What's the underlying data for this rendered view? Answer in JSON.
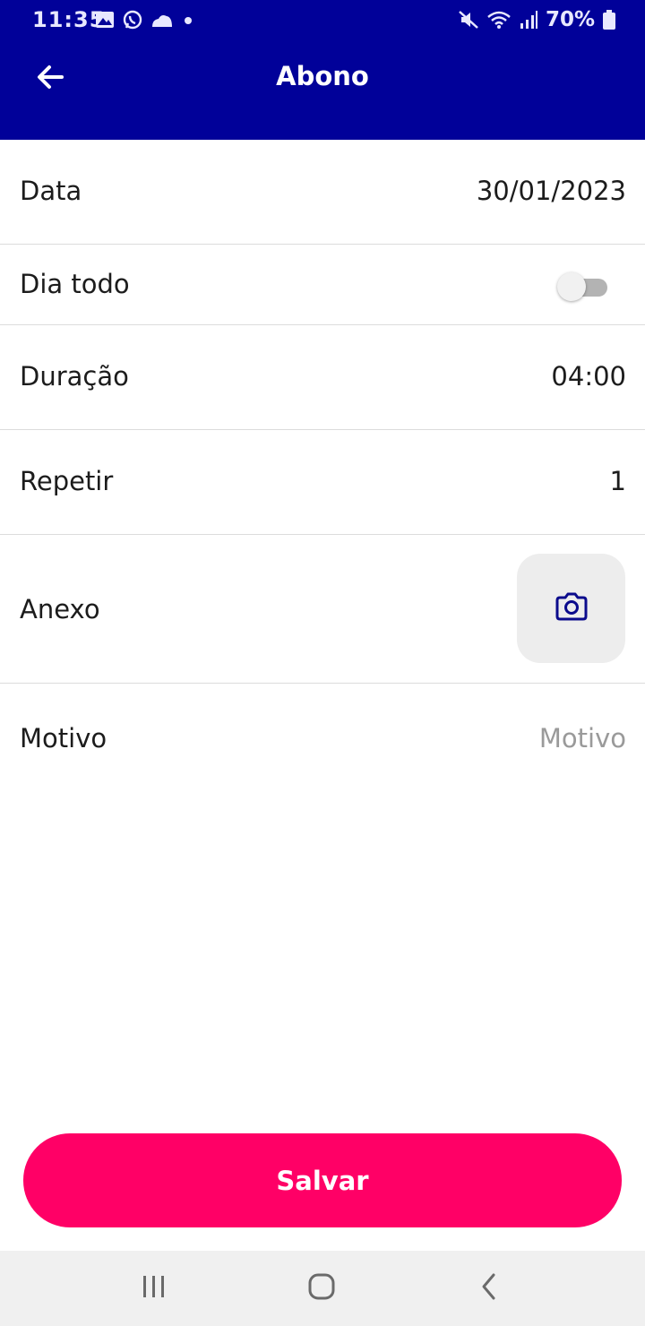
{
  "status_bar": {
    "time": "11:35",
    "battery": "70%",
    "icons": [
      "image-icon",
      "whatsapp-icon",
      "cloud-icon",
      "dot-icon",
      "mute-icon",
      "wifi-icon",
      "signal-icon",
      "battery-icon"
    ]
  },
  "app_bar": {
    "title": "Abono",
    "back_icon": "arrow-left-icon",
    "background": "#010199"
  },
  "form": {
    "data": {
      "label": "Data",
      "value": "30/01/2023"
    },
    "dia_todo": {
      "label": "Dia todo",
      "toggle_on": false
    },
    "duracao": {
      "label": "Duração",
      "value": "04:00"
    },
    "repetir": {
      "label": "Repetir",
      "value": "1"
    },
    "anexo": {
      "label": "Anexo",
      "button_icon": "camera-icon"
    },
    "motivo": {
      "label": "Motivo",
      "value": "",
      "placeholder": "Motivo"
    }
  },
  "save_button": {
    "label": "Salvar",
    "color": "#ff0066"
  },
  "nav_bar": {
    "icons": [
      "recents-icon",
      "home-icon",
      "back-chevron-icon"
    ]
  }
}
